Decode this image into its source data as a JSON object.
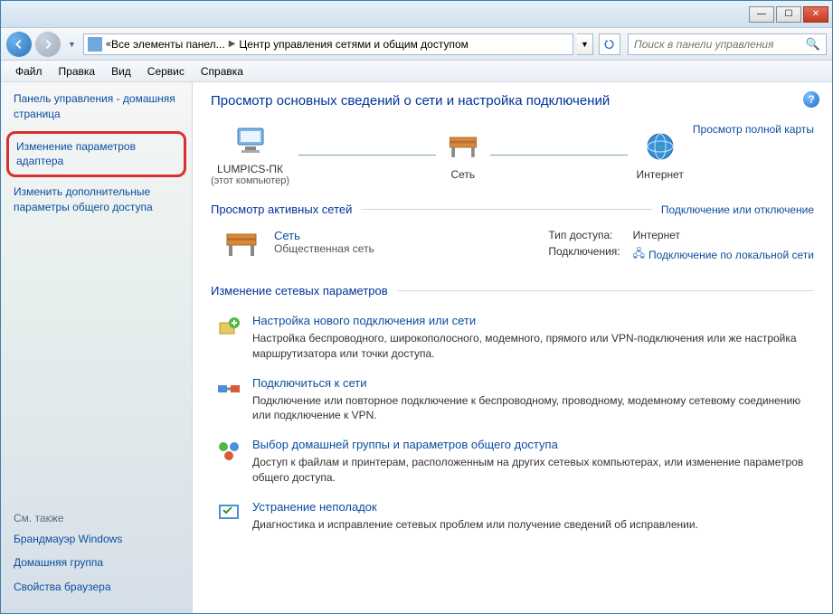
{
  "titlebar": {},
  "nav": {
    "breadcrumb": {
      "item1": "Все элементы панел...",
      "item2": "Центр управления сетями и общим доступом"
    },
    "search_placeholder": "Поиск в панели управления"
  },
  "menubar": [
    "Файл",
    "Правка",
    "Вид",
    "Сервис",
    "Справка"
  ],
  "sidebar": {
    "home": "Панель управления - домашняя страница",
    "adapter": "Изменение параметров адаптера",
    "sharing": "Изменить дополнительные параметры общего доступа",
    "see_also_title": "См. также",
    "see_also": [
      "Брандмауэр Windows",
      "Домашняя группа",
      "Свойства браузера"
    ]
  },
  "main": {
    "title": "Просмотр основных сведений о сети и настройка подключений",
    "full_map": "Просмотр полной карты",
    "map": {
      "pc_name": "LUMPICS-ПК",
      "pc_sub": "(этот компьютер)",
      "net_name": "Сеть",
      "inet_name": "Интернет"
    },
    "active": {
      "title": "Просмотр активных сетей",
      "connect_link": "Подключение или отключение",
      "name": "Сеть",
      "type": "Общественная сеть",
      "access_label": "Тип доступа:",
      "access_value": "Интернет",
      "conn_label": "Подключения:",
      "conn_value": "Подключение по локальной сети"
    },
    "change": {
      "title": "Изменение сетевых параметров",
      "tasks": [
        {
          "title": "Настройка нового подключения или сети",
          "desc": "Настройка беспроводного, широкополосного, модемного, прямого или VPN-подключения или же настройка маршрутизатора или точки доступа."
        },
        {
          "title": "Подключиться к сети",
          "desc": "Подключение или повторное подключение к беспроводному, проводному, модемному сетевому соединению или подключение к VPN."
        },
        {
          "title": "Выбор домашней группы и параметров общего доступа",
          "desc": "Доступ к файлам и принтерам, расположенным на других сетевых компьютерах, или изменение параметров общего доступа."
        },
        {
          "title": "Устранение неполадок",
          "desc": "Диагностика и исправление сетевых проблем или получение сведений об исправлении."
        }
      ]
    }
  }
}
